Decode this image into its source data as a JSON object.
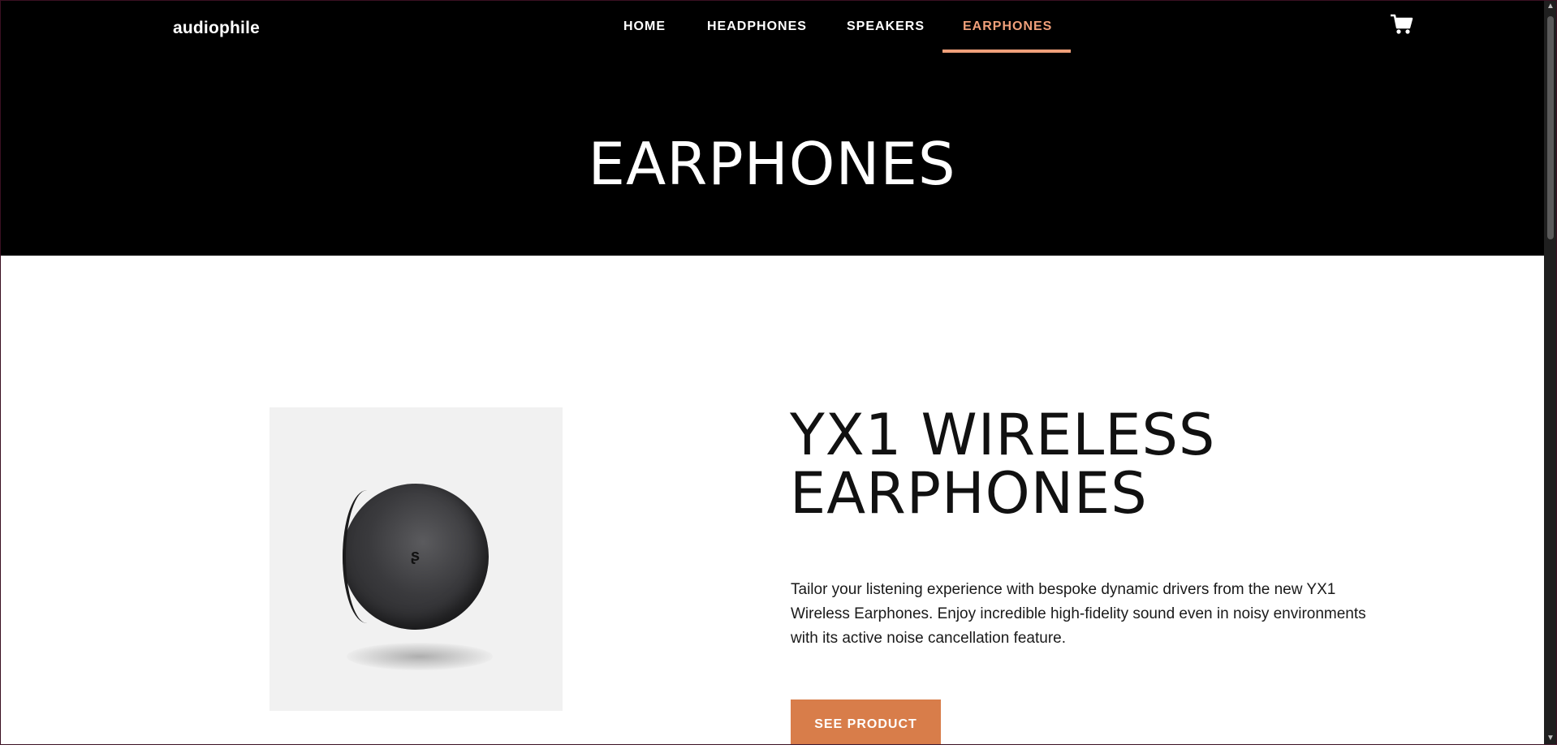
{
  "brand": {
    "logo_text": "audiophile"
  },
  "nav": {
    "items": [
      {
        "label": "HOME"
      },
      {
        "label": "HEADPHONES"
      },
      {
        "label": "SPEAKERS"
      },
      {
        "label": "EARPHONES",
        "active": true
      }
    ],
    "cart_icon": "cart-icon"
  },
  "hero": {
    "title": "EARPHONES"
  },
  "product": {
    "image_icon": "earbud-image",
    "title_line1": "YX1 WIRELESS",
    "title_line2": "EARPHONES",
    "description": "Tailor your listening experience with bespoke dynamic drivers from the new YX1 Wireless Earphones. Enjoy incredible high-fidelity sound even in noisy environments with its active noise cancellation feature.",
    "cta_label": "SEE PRODUCT"
  },
  "colors": {
    "header_bg": "#000000",
    "accent": "#d87d4a",
    "nav_active": "#f0a07a",
    "image_bg": "#f1f1f1"
  }
}
